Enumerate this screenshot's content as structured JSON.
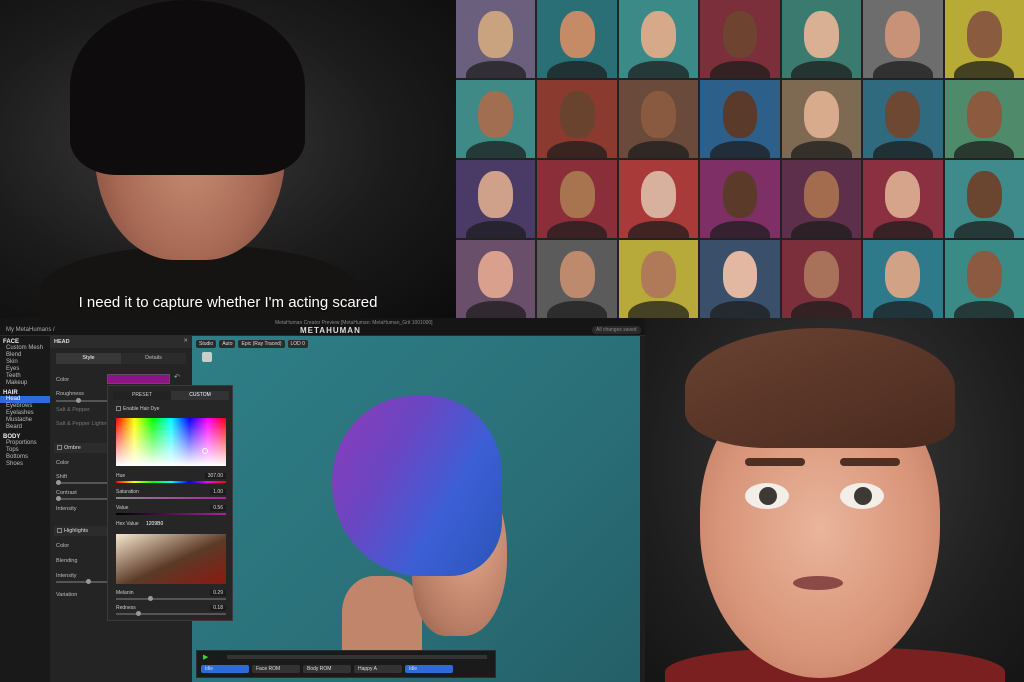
{
  "video": {
    "subtitle": "I need it to capture whether I'm acting scared"
  },
  "grid": {
    "cells": [
      {
        "bg": "#6b5f7e",
        "skin": "#c9a27f"
      },
      {
        "bg": "#2b6f76",
        "skin": "#c58a66"
      },
      {
        "bg": "#3c8a88",
        "skin": "#d7a98b"
      },
      {
        "bg": "#7a2f3a",
        "skin": "#6e4430"
      },
      {
        "bg": "#3b7a6e",
        "skin": "#d9b094"
      },
      {
        "bg": "#6d6d6d",
        "skin": "#c79277"
      },
      {
        "bg": "#b8aa37",
        "skin": "#8b5b40"
      },
      {
        "bg": "#3f8a86",
        "skin": "#a16e52"
      },
      {
        "bg": "#8a3a2f",
        "skin": "#6a432f"
      },
      {
        "bg": "#6a4a3a",
        "skin": "#8a5a40"
      },
      {
        "bg": "#2c5f8a",
        "skin": "#5a3a2a"
      },
      {
        "bg": "#7e6a52",
        "skin": "#d8ab8c"
      },
      {
        "bg": "#2f6a7e",
        "skin": "#6e4833"
      },
      {
        "bg": "#4f8a6a",
        "skin": "#8c5a3e"
      },
      {
        "bg": "#4a3a66",
        "skin": "#cfa08a"
      },
      {
        "bg": "#8a2f3a",
        "skin": "#a8734f"
      },
      {
        "bg": "#a83a3a",
        "skin": "#d7b19e"
      },
      {
        "bg": "#7e2f66",
        "skin": "#5c3a2a"
      },
      {
        "bg": "#5e2f4a",
        "skin": "#a46c4f"
      },
      {
        "bg": "#8a3040",
        "skin": "#d5a48a"
      },
      {
        "bg": "#3f8a8a",
        "skin": "#6a4530"
      },
      {
        "bg": "#6a4f6a",
        "skin": "#d9a08d"
      },
      {
        "bg": "#5b5b5b",
        "skin": "#bd8a6e"
      },
      {
        "bg": "#b8aa3a",
        "skin": "#b07a58"
      },
      {
        "bg": "#3a4f6a",
        "skin": "#e3b8a3"
      },
      {
        "bg": "#7a2f3a",
        "skin": "#a8725a"
      },
      {
        "bg": "#2f7a8a",
        "skin": "#d1a285"
      },
      {
        "bg": "#3a8a86",
        "skin": "#8c5a40"
      }
    ]
  },
  "editor": {
    "crumb": "My MetaHumans /",
    "window_title": "MetaHuman Creator Preview [MetaHuman: MetaHuman_Grit 1001000]",
    "logo": "METAHUMAN",
    "changes": "All changes saved",
    "sidebar": [
      {
        "section": "FACE",
        "items": [
          "Custom Mesh",
          "Blend",
          "Skin",
          "Eyes",
          "Teeth",
          "Makeup"
        ]
      },
      {
        "section": "HAIR",
        "items": [
          "Head",
          "Eyebrows",
          "Eyelashes",
          "Mustache",
          "Beard"
        ]
      },
      {
        "section": "BODY",
        "items": [
          "Proportions",
          "Tops",
          "Bottoms",
          "Shoes"
        ]
      }
    ],
    "active_item": "Head",
    "panel": {
      "title": "HEAD",
      "close": "✕",
      "tab_style": "Style",
      "tab_details": "Details",
      "color": "Color",
      "roughness": "Roughness",
      "salt_pepper": "Salt & Pepper",
      "salt_pepper_light": "Salt & Pepper Lightness",
      "ombre": "Ombre",
      "ombre_color": "Color",
      "shift": "Shift",
      "contrast": "Contrast",
      "intensity": "Intensity",
      "highlights": "Highlights",
      "hl_color": "Color",
      "blending": "Blending",
      "hl_intensity": "Intensity",
      "variation": "Variation",
      "swatch_color": "#8f1287"
    },
    "picker": {
      "tab_preset": "PRESET",
      "tab_custom": "CUSTOM",
      "enable": "Enable Hair Dye",
      "hue": "Hue",
      "hue_val": "307.00",
      "saturation": "Saturation",
      "sat_val": "1.00",
      "value": "Value",
      "val_val": "0.56",
      "hex_label": "Hex Value",
      "hex": "1209B0",
      "melanin": "Melanin",
      "mel_val": "0.29",
      "redness": "Redness",
      "red_val": "0.18"
    },
    "viewport_buttons": [
      "Studio",
      "Auto",
      "Epic (Ray Traced)",
      "LOD 0"
    ],
    "timeline": [
      "Idle",
      "Face ROM",
      "Body ROM",
      "Happy A",
      "Idle"
    ]
  }
}
